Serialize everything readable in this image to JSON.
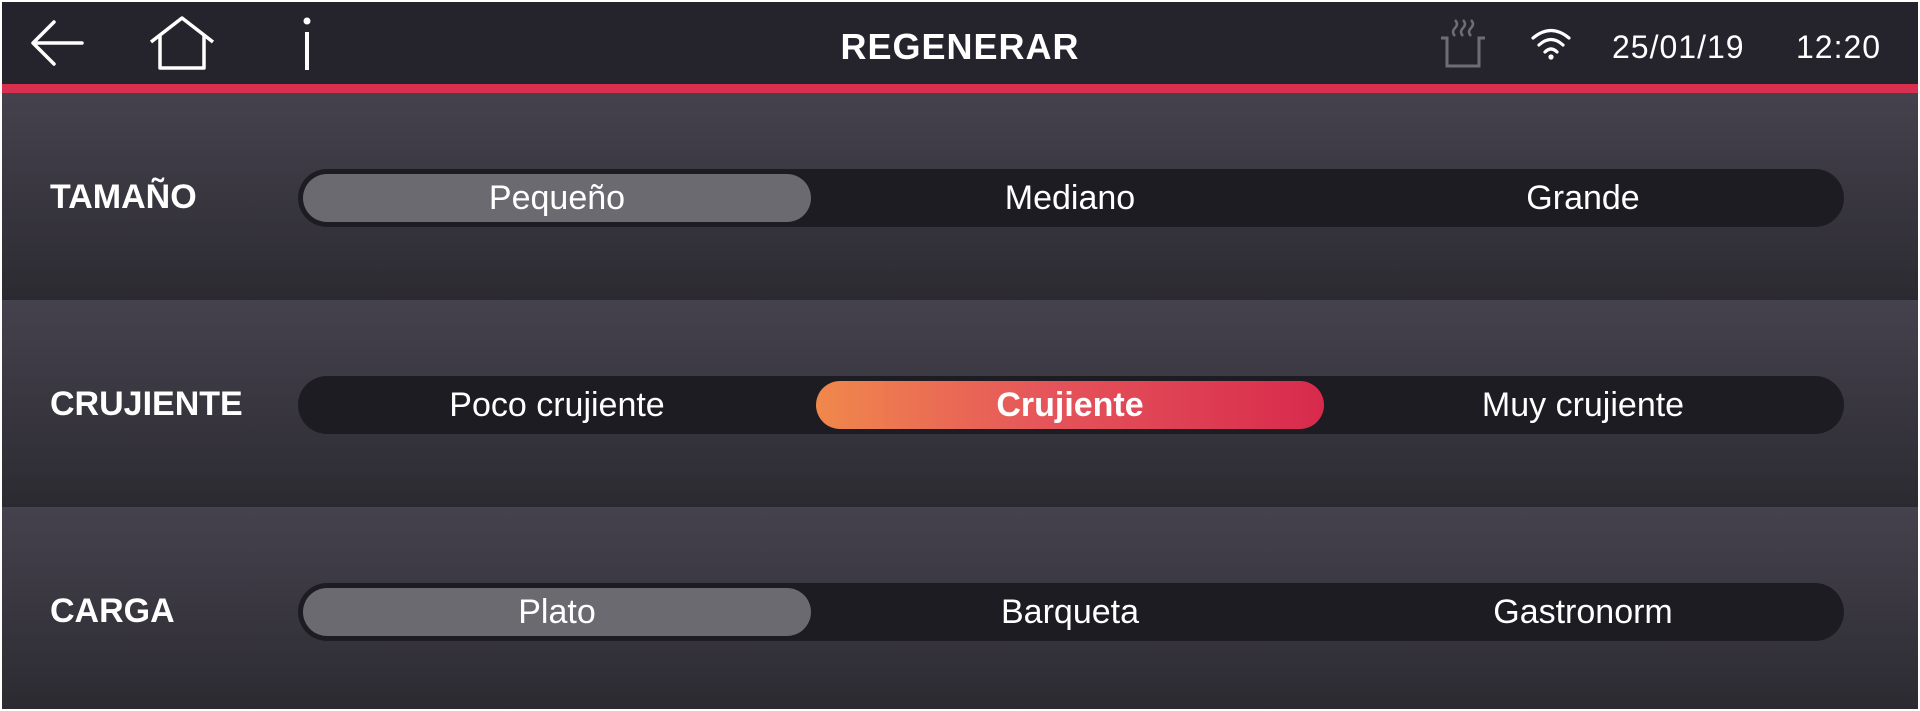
{
  "header": {
    "title": "REGENERAR",
    "date": "25/01/19",
    "time": "12:20",
    "back_icon": "arrow-left-icon",
    "home_icon": "home-icon",
    "info_icon": "info-icon",
    "steam_icon": "steam-tray-icon",
    "wifi_icon": "wifi-icon"
  },
  "colors": {
    "accent_line": "#d8304e",
    "gradient_start": "#f0884c",
    "gradient_end": "#d82a4c",
    "selected_grey": "#6c6a71"
  },
  "rows": [
    {
      "label": "TAMAÑO",
      "options": [
        "Pequeño",
        "Mediano",
        "Grande"
      ],
      "selected": "Pequeño",
      "selected_style": "grey"
    },
    {
      "label": "CRUJIENTE",
      "options": [
        "Poco crujiente",
        "Crujiente",
        "Muy crujiente"
      ],
      "selected": "Crujiente",
      "selected_style": "accent"
    },
    {
      "label": "CARGA",
      "options": [
        "Plato",
        "Barqueta",
        "Gastronorm"
      ],
      "selected": "Plato",
      "selected_style": "grey"
    }
  ]
}
